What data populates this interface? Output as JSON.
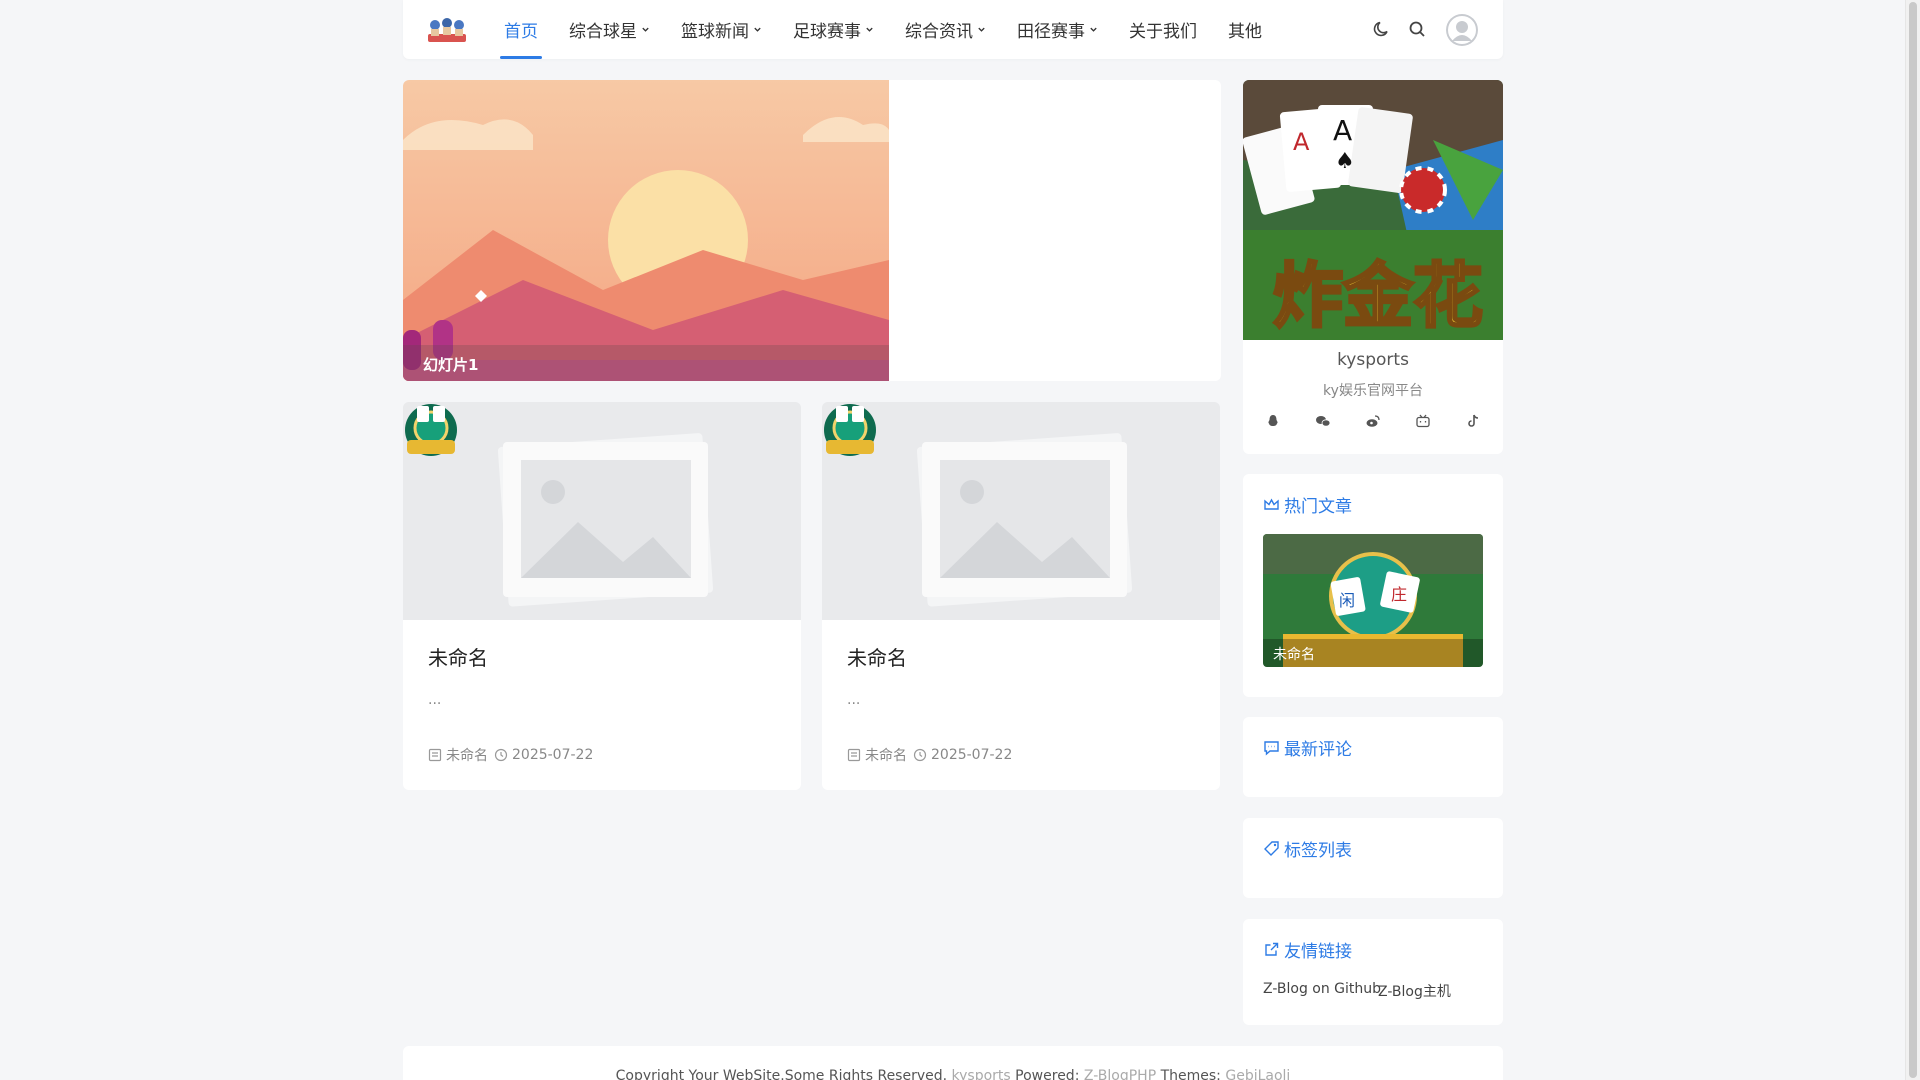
{
  "header": {
    "logo": "site-logo",
    "nav": [
      {
        "label": "首页",
        "active": true,
        "dropdown": false
      },
      {
        "label": "综合球星",
        "active": false,
        "dropdown": true
      },
      {
        "label": "篮球新闻",
        "active": false,
        "dropdown": true
      },
      {
        "label": "足球赛事",
        "active": false,
        "dropdown": true
      },
      {
        "label": "综合资讯",
        "active": false,
        "dropdown": true
      },
      {
        "label": "田径赛事",
        "active": false,
        "dropdown": true
      },
      {
        "label": "关于我们",
        "active": false,
        "dropdown": false
      },
      {
        "label": "其他",
        "active": false,
        "dropdown": false
      }
    ],
    "icons": [
      "moon-icon",
      "search-icon",
      "user-avatar"
    ]
  },
  "slider": {
    "caption": "幻灯片1"
  },
  "posts": [
    {
      "title": "未命名",
      "excerpt": "...",
      "category": "未命名",
      "date": "2025-07-22"
    },
    {
      "title": "未命名",
      "excerpt": "...",
      "category": "未命名",
      "date": "2025-07-22"
    }
  ],
  "profile": {
    "name": "kysports",
    "desc": "ky娱乐官网平台",
    "socials": [
      "qq-icon",
      "wechat-icon",
      "weibo-icon",
      "bilibili-icon",
      "tiktok-icon"
    ]
  },
  "widgets": {
    "hot_title": "热门文章",
    "hot_item": "未命名",
    "comments_title": "最新评论",
    "tags_title": "标签列表",
    "links_title": "友情链接",
    "links": [
      "Z-Blog on Github",
      "Z-Blog主机"
    ]
  },
  "footer": {
    "text1": "Copyright Your WebSite.Some Rights Reserved.",
    "site": "kysports",
    "text2": "Powered:",
    "powered": "Z-BlogPHP",
    "text3": "Themes:",
    "theme": "GebiLaoli"
  },
  "colors": {
    "accent": "#2d7be5",
    "background": "#f5f6f8"
  }
}
